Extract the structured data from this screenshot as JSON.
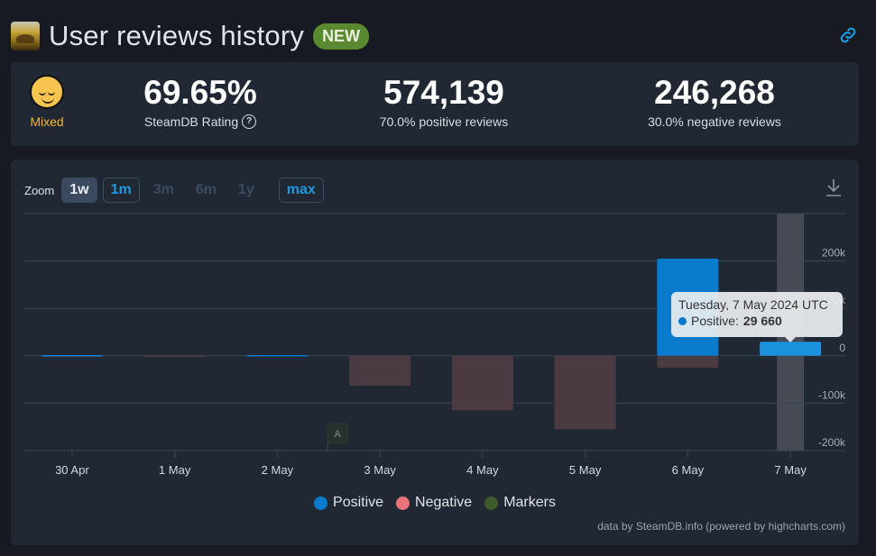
{
  "header": {
    "title": "User reviews history",
    "badge": "NEW",
    "link_icon": "link-icon",
    "game_icon": "game-capsule-icon"
  },
  "stats": {
    "mood_label": "Mixed",
    "mood_icon": "pensive-face-emoji",
    "rating_value": "69.65%",
    "rating_label": "SteamDB Rating",
    "help_icon": "question-circle-icon",
    "help_glyph": "?",
    "positive_count": "574,139",
    "positive_label": "70.0% positive reviews",
    "negative_count": "246,268",
    "negative_label": "30.0% negative reviews"
  },
  "zoom": {
    "label": "Zoom",
    "buttons": [
      {
        "label": "1w",
        "state": "active"
      },
      {
        "label": "1m",
        "state": "outlined"
      },
      {
        "label": "3m",
        "state": "disabled"
      },
      {
        "label": "6m",
        "state": "disabled"
      },
      {
        "label": "1y",
        "state": "disabled"
      },
      {
        "label": "max",
        "state": "outlined"
      }
    ]
  },
  "tooltip": {
    "date": "Tuesday, 7 May 2024 UTC",
    "series": "Positive: ",
    "value": "29 660"
  },
  "colors": {
    "positive": "#0a7acc",
    "positive_hover": "#1b92dc",
    "negative": "#4c3a43",
    "negative_legend": "#e8737a",
    "markers": "#3e5a2a"
  },
  "credit": "data by SteamDB.info (powered by highcharts.com)",
  "chart_data": {
    "type": "bar",
    "title": "",
    "xlabel": "",
    "ylabel": "",
    "categories": [
      "30 Apr",
      "1 May",
      "2 May",
      "3 May",
      "4 May",
      "5 May",
      "6 May",
      "7 May"
    ],
    "series": [
      {
        "name": "Positive",
        "values": [
          1500,
          0,
          1500,
          0,
          0,
          0,
          205000,
          29660
        ]
      },
      {
        "name": "Negative",
        "values": [
          -1500,
          -1000,
          0,
          -63000,
          -115000,
          -155000,
          -25000,
          0
        ]
      },
      {
        "name": "Markers",
        "values": [],
        "annotations": [
          {
            "x": "3 May",
            "label": "A"
          }
        ]
      }
    ],
    "y_ticks": [
      -200000,
      -100000,
      0,
      100000,
      200000,
      300000
    ],
    "y_tick_labels": [
      "-200k",
      "-100k",
      "0",
      "100k",
      "200k",
      ""
    ],
    "ylim": [
      -200000,
      300000
    ],
    "grid": true,
    "legend": [
      "Positive",
      "Negative",
      "Markers"
    ],
    "legend_position": "bottom-center",
    "highlighted_category": "7 May"
  }
}
